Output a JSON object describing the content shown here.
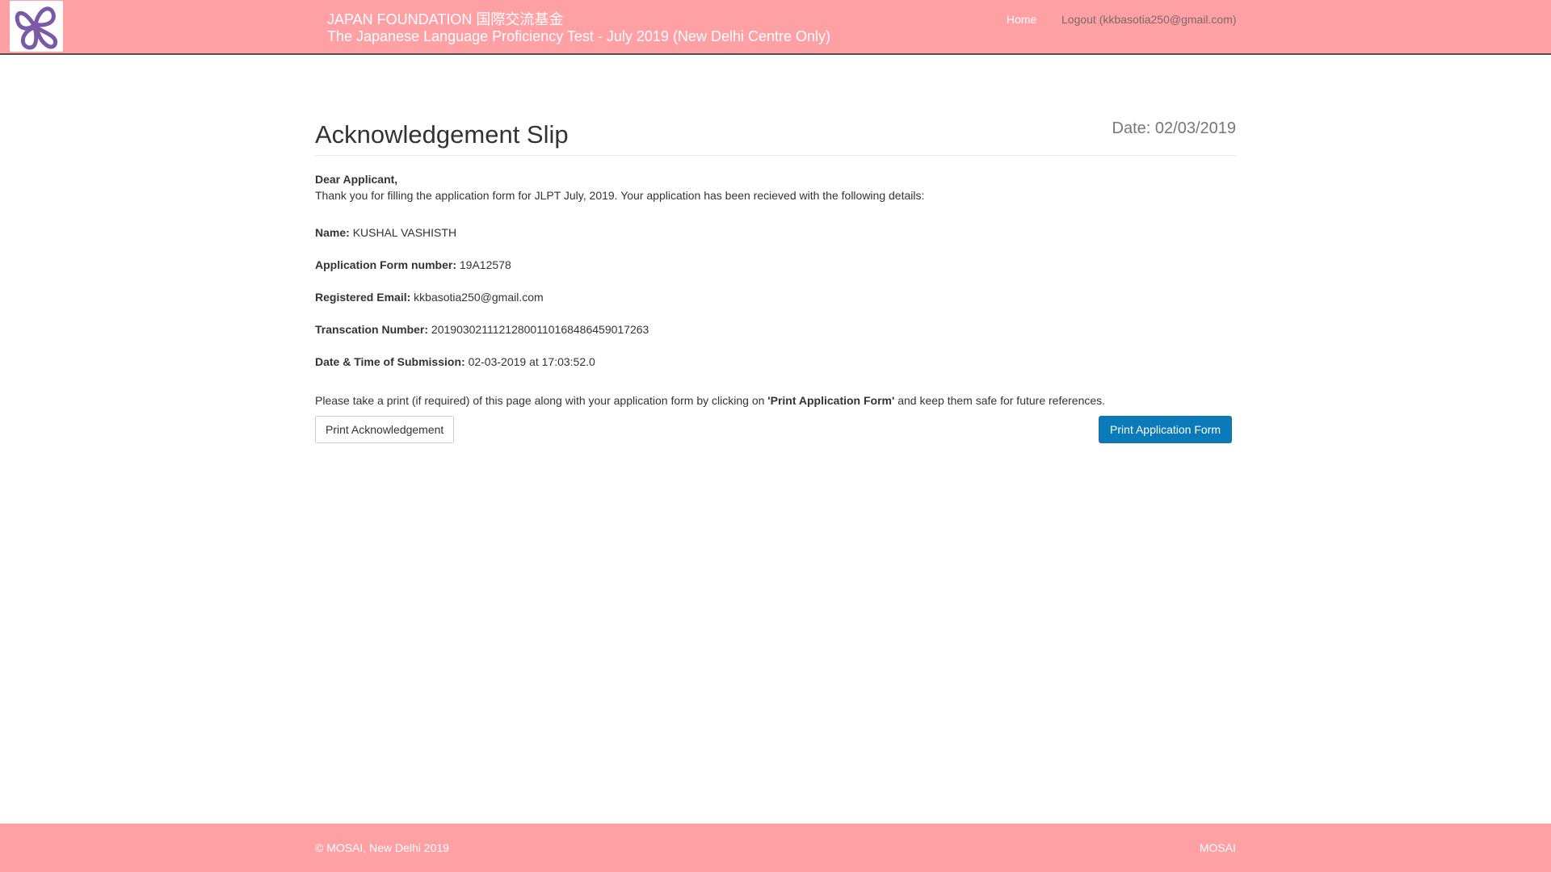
{
  "header": {
    "brand_line1": "JAPAN FOUNDATION 国際交流基金",
    "brand_line2": "The Japanese Language Proficiency Test - July 2019 (New Delhi Centre Only)",
    "nav": {
      "home": "Home",
      "logout": "Logout (kkbasotia250@gmail.com)"
    },
    "logo_icon": "butterfly-logo-icon",
    "colors": {
      "bar": "#ffa1a4",
      "logo_purple": "#7a5aa6"
    }
  },
  "main": {
    "title": "Acknowledgement Slip",
    "date": "Date: 02/03/2019",
    "greeting": "Dear Applicant,",
    "intro": "Thank you for filling the application form for JLPT July, 2019. Your application has been recieved with the following details:",
    "details": [
      {
        "label": "Name:",
        "value": "KUSHAL VASHISTH"
      },
      {
        "label": "Application Form number:",
        "value": "19A12578"
      },
      {
        "label": "Registered Email:",
        "value": "kkbasotia250@gmail.com"
      },
      {
        "label": "Transcation Number:",
        "value": "20190302111212800110168486459017263"
      },
      {
        "label": "Date & Time of Submission:",
        "value": "02-03-2019 at 17:03:52.0"
      }
    ],
    "note_prefix": "Please take a print (if required) of this page along with your application form by clicking on ",
    "note_bold": "'Print Application Form'",
    "note_suffix": " and keep them safe for future references.",
    "buttons": {
      "print_ack": "Print Acknowledgement",
      "print_app": "Print Application Form"
    },
    "colors": {
      "primary_button": "#0a7ab8"
    }
  },
  "footer": {
    "copyright": "© MOSAI, New Delhi 2019",
    "link": "MOSAI"
  }
}
